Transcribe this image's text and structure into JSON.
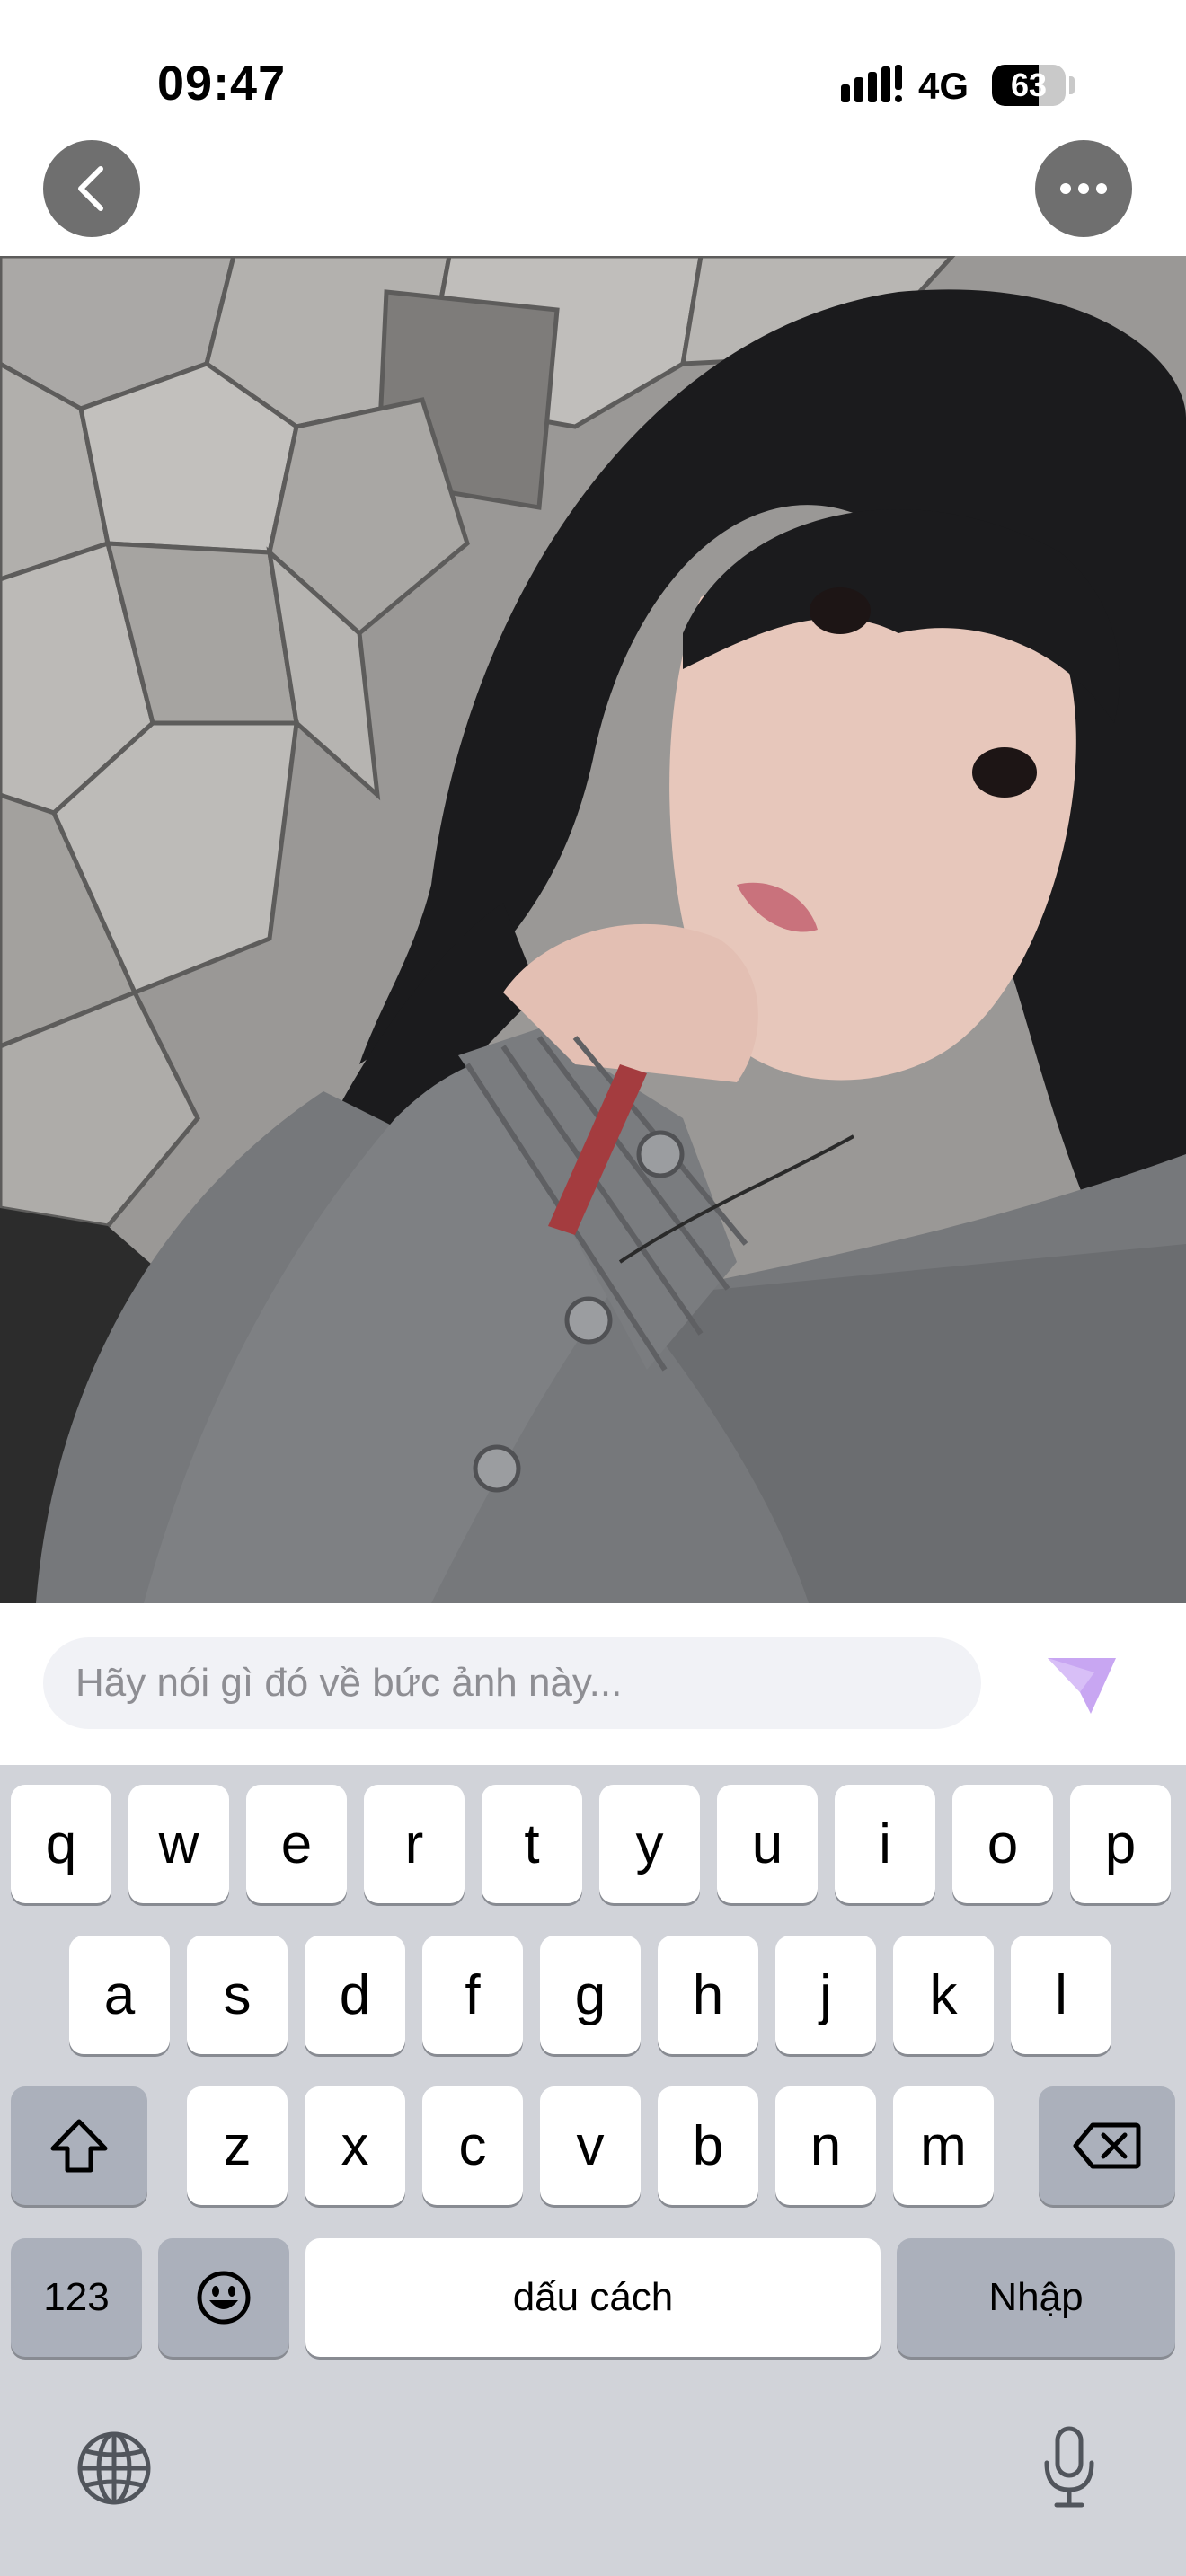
{
  "status_bar": {
    "time": "09:47",
    "network": "4G",
    "battery": "63",
    "battery_level": 0.63
  },
  "nav": {
    "back_icon": "chevron-left-icon",
    "more_icon": "ellipsis-icon"
  },
  "photo": {
    "subject": "selfie-photo"
  },
  "comment": {
    "placeholder": "Hãy nói gì đó về bức ảnh này...",
    "value": "",
    "send_icon": "send-icon",
    "send_color": "#c8a6f2"
  },
  "keyboard": {
    "row1": [
      "q",
      "w",
      "e",
      "r",
      "t",
      "y",
      "u",
      "i",
      "o",
      "p"
    ],
    "row2": [
      "a",
      "s",
      "d",
      "f",
      "g",
      "h",
      "j",
      "k",
      "l"
    ],
    "row3": [
      "z",
      "x",
      "c",
      "v",
      "b",
      "n",
      "m"
    ],
    "numbers_label": "123",
    "space_label": "dấu cách",
    "return_label": "Nhập",
    "shift_icon": "shift-icon",
    "backspace_icon": "backspace-icon",
    "emoji_icon": "emoji-icon",
    "globe_icon": "globe-icon",
    "mic_icon": "microphone-icon"
  }
}
